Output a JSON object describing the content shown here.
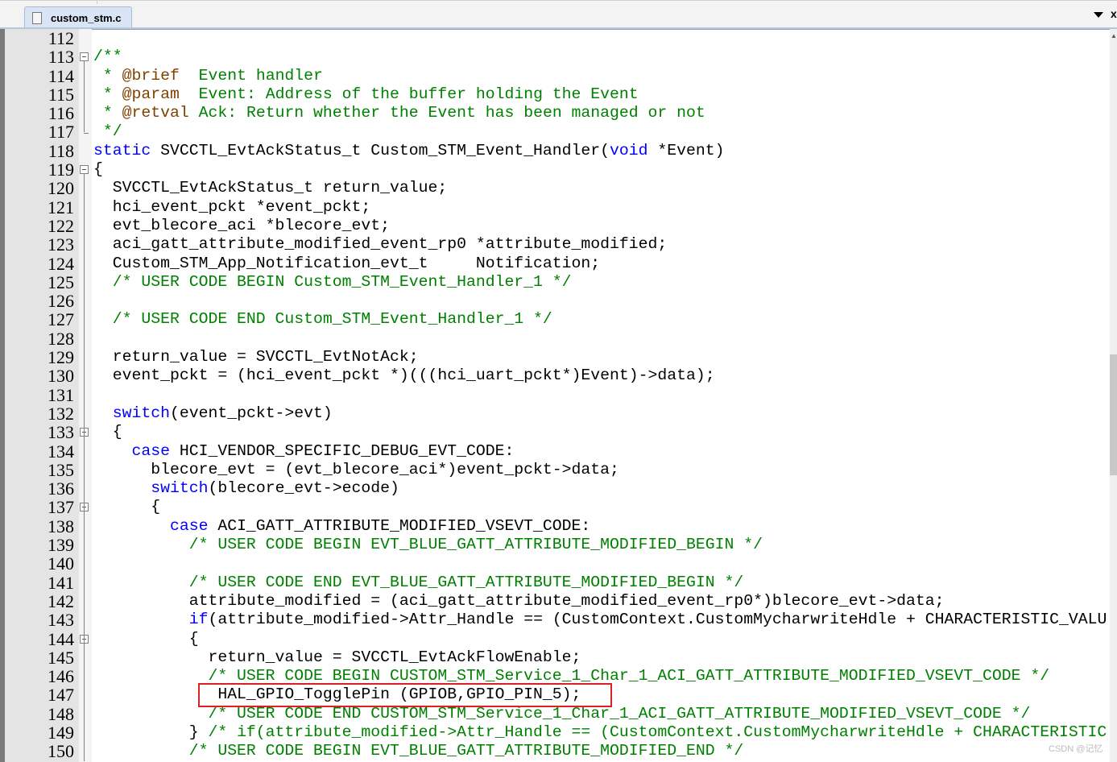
{
  "tab": {
    "filename": "custom_stm.c",
    "icon": "file-icon"
  },
  "controls": {
    "dropdown_icon": "dropdown-triangle-icon",
    "close_icon": "close-icon",
    "close_label": "x"
  },
  "watermark": "CSDN @记忆",
  "highlight": {
    "line": 147,
    "color": "#e02020"
  },
  "colors": {
    "keyword": "#0000ff",
    "comment": "#008000",
    "doc_tag": "#804000",
    "text": "#000000"
  },
  "lines": [
    {
      "num": "112",
      "tokens": []
    },
    {
      "num": "113",
      "fold": "open",
      "tokens": [
        {
          "t": "/**",
          "c": "cm"
        }
      ]
    },
    {
      "num": "114",
      "tokens": [
        {
          "t": " * ",
          "c": "cm"
        },
        {
          "t": "@brief",
          "c": "tag"
        },
        {
          "t": "  Event handler",
          "c": "cm"
        }
      ]
    },
    {
      "num": "115",
      "tokens": [
        {
          "t": " * ",
          "c": "cm"
        },
        {
          "t": "@param",
          "c": "tag"
        },
        {
          "t": "  Event: Address of the buffer holding the Event",
          "c": "cm"
        }
      ]
    },
    {
      "num": "116",
      "tokens": [
        {
          "t": " * ",
          "c": "cm"
        },
        {
          "t": "@retval",
          "c": "tag"
        },
        {
          "t": " Ack: Return whether the Event has been managed or not",
          "c": "cm"
        }
      ]
    },
    {
      "num": "117",
      "fold": "end",
      "tokens": [
        {
          "t": " */",
          "c": "cm"
        }
      ]
    },
    {
      "num": "118",
      "tokens": [
        {
          "t": "static",
          "c": "kw"
        },
        {
          "t": " SVCCTL_EvtAckStatus_t Custom_STM_Event_Handler(",
          "c": ""
        },
        {
          "t": "void",
          "c": "kw"
        },
        {
          "t": " *Event)",
          "c": ""
        }
      ]
    },
    {
      "num": "119",
      "fold": "open",
      "tokens": [
        {
          "t": "{",
          "c": ""
        }
      ]
    },
    {
      "num": "120",
      "tokens": [
        {
          "t": "  SVCCTL_EvtAckStatus_t return_value;",
          "c": ""
        }
      ]
    },
    {
      "num": "121",
      "tokens": [
        {
          "t": "  hci_event_pckt *event_pckt;",
          "c": ""
        }
      ]
    },
    {
      "num": "122",
      "tokens": [
        {
          "t": "  evt_blecore_aci *blecore_evt;",
          "c": ""
        }
      ]
    },
    {
      "num": "123",
      "tokens": [
        {
          "t": "  aci_gatt_attribute_modified_event_rp0 *attribute_modified;",
          "c": ""
        }
      ]
    },
    {
      "num": "124",
      "tokens": [
        {
          "t": "  Custom_STM_App_Notification_evt_t     Notification;",
          "c": ""
        }
      ]
    },
    {
      "num": "125",
      "tokens": [
        {
          "t": "  /* USER CODE BEGIN Custom_STM_Event_Handler_1 */",
          "c": "cm"
        }
      ]
    },
    {
      "num": "126",
      "tokens": []
    },
    {
      "num": "127",
      "tokens": [
        {
          "t": "  /* USER CODE END Custom_STM_Event_Handler_1 */",
          "c": "cm"
        }
      ]
    },
    {
      "num": "128",
      "tokens": []
    },
    {
      "num": "129",
      "tokens": [
        {
          "t": "  return_value = SVCCTL_EvtNotAck;",
          "c": ""
        }
      ]
    },
    {
      "num": "130",
      "tokens": [
        {
          "t": "  event_pckt = (hci_event_pckt *)(((hci_uart_pckt*)Event)->data);",
          "c": ""
        }
      ]
    },
    {
      "num": "131",
      "tokens": []
    },
    {
      "num": "132",
      "tokens": [
        {
          "t": "  ",
          "c": ""
        },
        {
          "t": "switch",
          "c": "kw"
        },
        {
          "t": "(event_pckt->evt)",
          "c": ""
        }
      ]
    },
    {
      "num": "133",
      "fold": "open",
      "tokens": [
        {
          "t": "  {",
          "c": ""
        }
      ]
    },
    {
      "num": "134",
      "tokens": [
        {
          "t": "    ",
          "c": ""
        },
        {
          "t": "case",
          "c": "kw"
        },
        {
          "t": " HCI_VENDOR_SPECIFIC_DEBUG_EVT_CODE:",
          "c": ""
        }
      ]
    },
    {
      "num": "135",
      "tokens": [
        {
          "t": "      blecore_evt = (evt_blecore_aci*)event_pckt->data;",
          "c": ""
        }
      ]
    },
    {
      "num": "136",
      "tokens": [
        {
          "t": "      ",
          "c": ""
        },
        {
          "t": "switch",
          "c": "kw"
        },
        {
          "t": "(blecore_evt->ecode)",
          "c": ""
        }
      ]
    },
    {
      "num": "137",
      "fold": "open",
      "tokens": [
        {
          "t": "      {",
          "c": ""
        }
      ]
    },
    {
      "num": "138",
      "tokens": [
        {
          "t": "        ",
          "c": ""
        },
        {
          "t": "case",
          "c": "kw"
        },
        {
          "t": " ACI_GATT_ATTRIBUTE_MODIFIED_VSEVT_CODE:",
          "c": ""
        }
      ]
    },
    {
      "num": "139",
      "tokens": [
        {
          "t": "          /* USER CODE BEGIN EVT_BLUE_GATT_ATTRIBUTE_MODIFIED_BEGIN */",
          "c": "cm"
        }
      ]
    },
    {
      "num": "140",
      "tokens": []
    },
    {
      "num": "141",
      "tokens": [
        {
          "t": "          /* USER CODE END EVT_BLUE_GATT_ATTRIBUTE_MODIFIED_BEGIN */",
          "c": "cm"
        }
      ]
    },
    {
      "num": "142",
      "tokens": [
        {
          "t": "          attribute_modified = (aci_gatt_attribute_modified_event_rp0*)blecore_evt->data;",
          "c": ""
        }
      ]
    },
    {
      "num": "143",
      "tokens": [
        {
          "t": "          ",
          "c": ""
        },
        {
          "t": "if",
          "c": "kw"
        },
        {
          "t": "(attribute_modified->Attr_Handle == (CustomContext.CustomMycharwriteHdle + CHARACTERISTIC_VALU",
          "c": ""
        }
      ]
    },
    {
      "num": "144",
      "fold": "open",
      "tokens": [
        {
          "t": "          {",
          "c": ""
        }
      ]
    },
    {
      "num": "145",
      "tokens": [
        {
          "t": "            return_value = SVCCTL_EvtAckFlowEnable;",
          "c": ""
        }
      ]
    },
    {
      "num": "146",
      "tokens": [
        {
          "t": "            /* USER CODE BEGIN CUSTOM_STM_Service_1_Char_1_ACI_GATT_ATTRIBUTE_MODIFIED_VSEVT_CODE */",
          "c": "cm"
        }
      ]
    },
    {
      "num": "147",
      "tokens": [
        {
          "t": "             HAL_GPIO_TogglePin (GPIOB,GPIO_PIN_5);",
          "c": ""
        }
      ]
    },
    {
      "num": "148",
      "tokens": [
        {
          "t": "            /* USER CODE END CUSTOM_STM_Service_1_Char_1_ACI_GATT_ATTRIBUTE_MODIFIED_VSEVT_CODE */",
          "c": "cm"
        }
      ]
    },
    {
      "num": "149",
      "fold": "end",
      "tokens": [
        {
          "t": "          } ",
          "c": ""
        },
        {
          "t": "/* if(attribute_modified->Attr_Handle == (CustomContext.CustomMycharwriteHdle + CHARACTERISTIC",
          "c": "cm"
        }
      ]
    },
    {
      "num": "150",
      "tokens": [
        {
          "t": "          /* USER CODE BEGIN EVT_BLUE_GATT_ATTRIBUTE_MODIFIED_END */",
          "c": "cm"
        }
      ]
    }
  ]
}
